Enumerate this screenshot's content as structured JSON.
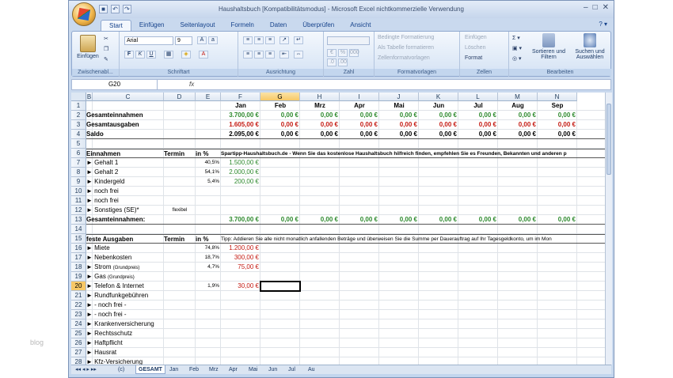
{
  "watermark": "blog",
  "window": {
    "title": "Haushaltsbuch  [Kompatibilitätsmodus]  -  Microsoft Excel nichtkommerzielle Verwendung"
  },
  "ribbon_tabs": [
    "Start",
    "Einfügen",
    "Seitenlayout",
    "Formeln",
    "Daten",
    "Überprüfen",
    "Ansicht"
  ],
  "ribbon": {
    "paste_label": "Einfügen",
    "clipboard_label": "Zwischenabl...",
    "font_name": "Arial",
    "font_size": "9",
    "font_label": "Schriftart",
    "align_label": "Ausrichtung",
    "number_label": "Zahl",
    "cond_format": "Bedingte Formatierung",
    "as_table": "Als Tabelle formatieren",
    "cell_styles": "Zellenformatvorlagen",
    "styles_label": "Formatvorlagen",
    "insert": "Einfügen",
    "delete": "Löschen",
    "format": "Format",
    "cells_label": "Zellen",
    "sort_filter": "Sortieren und Filtern",
    "find_select": "Suchen und Auswählen",
    "edit_label": "Bearbeiten"
  },
  "formula_bar": {
    "name_box": "G20",
    "fx": "fx",
    "value": ""
  },
  "columns": [
    "B",
    "C",
    "D",
    "E",
    "F",
    "G",
    "H",
    "I",
    "J",
    "K",
    "L",
    "M",
    "N"
  ],
  "selected_col": "G",
  "selected_row": "20",
  "months": [
    "Jan",
    "Feb",
    "Mrz",
    "Apr",
    "Mai",
    "Jun",
    "Jul",
    "Aug",
    "Sep"
  ],
  "summary": [
    {
      "label": "Gesamteinnahmen",
      "values": [
        "3.700,00 €",
        "0,00 €",
        "0,00 €",
        "0,00 €",
        "0,00 €",
        "0,00 €",
        "0,00 €",
        "0,00 €",
        "0,00 €"
      ],
      "color": "#2e8a2e"
    },
    {
      "label": "Gesamtausgaben",
      "values": [
        "1.605,00 €",
        "0,00 €",
        "0,00 €",
        "0,00 €",
        "0,00 €",
        "0,00 €",
        "0,00 €",
        "0,00 €",
        "0,00 €"
      ],
      "color": "#c41a12"
    },
    {
      "label": "Saldo",
      "values": [
        "2.095,00 €",
        "0,00 €",
        "0,00 €",
        "0,00 €",
        "0,00 €",
        "0,00 €",
        "0,00 €",
        "0,00 €",
        "0,00 €"
      ],
      "color": "#000000"
    }
  ],
  "income": {
    "header": "Einnahmen",
    "termin": "Termin",
    "pct": "in %",
    "tip": "Spartipp-Haushaltsbuch.de - Wenn Sie das kostenlose Haushaltsbuch hilfreich finden, empfehlen Sie es Freunden, Bekannten und anderen p",
    "rows": [
      {
        "n": "7",
        "label": "► Gehalt 1",
        "termin": "",
        "pct": "40,5%",
        "jan": "1.500,00 €"
      },
      {
        "n": "8",
        "label": "► Gehalt 2",
        "termin": "",
        "pct": "54,1%",
        "jan": "2.000,00 €"
      },
      {
        "n": "9",
        "label": "► Kindergeld",
        "termin": "",
        "pct": "5,4%",
        "jan": "200,00 €"
      },
      {
        "n": "10",
        "label": "► noch frei",
        "termin": "",
        "pct": "",
        "jan": ""
      },
      {
        "n": "11",
        "label": "► noch frei",
        "termin": "",
        "pct": "",
        "jan": ""
      },
      {
        "n": "12",
        "label": "► Sonstiges (SE)*",
        "termin": "flexibel",
        "pct": "",
        "jan": ""
      }
    ],
    "total_label": "Gesamteinnahmen:",
    "total_values": [
      "3.700,00 €",
      "0,00 €",
      "0,00 €",
      "0,00 €",
      "0,00 €",
      "0,00 €",
      "0,00 €",
      "0,00 €",
      "0,00 €"
    ]
  },
  "expenses": {
    "header": "feste Ausgaben",
    "termin": "Termin",
    "pct": "in %",
    "tip": "Tipp: Addieren Sie alle nicht monatlich anfallenden Beträge und überweisen Sie die Summe per Dauerauftrag auf Ihr Tagesgeldkonto, um im Mon",
    "rows": [
      {
        "n": "16",
        "label": "► Miete",
        "pct": "74,8%",
        "jan": "1.200,00 €"
      },
      {
        "n": "17",
        "label": "► Nebenkosten",
        "pct": "18,7%",
        "jan": "300,00 €"
      },
      {
        "n": "18",
        "label": "► Strom",
        "sub": "(Grundpreis)",
        "pct": "4,7%",
        "jan": "75,00 €"
      },
      {
        "n": "19",
        "label": "► Gas",
        "sub": "(Grundpreis)",
        "pct": "",
        "jan": ""
      },
      {
        "n": "20",
        "label": "► Telefon & Internet",
        "pct": "1,9%",
        "jan": "30,00 €"
      },
      {
        "n": "21",
        "label": "► Rundfunkgebühren",
        "pct": "",
        "jan": ""
      },
      {
        "n": "22",
        "label": "►  - noch frei -",
        "pct": "",
        "jan": ""
      },
      {
        "n": "23",
        "label": "►  - noch frei -",
        "pct": "",
        "jan": ""
      },
      {
        "n": "24",
        "label": "► Krankenversicherung",
        "pct": "",
        "jan": ""
      },
      {
        "n": "25",
        "label": "► Rechtsschutz",
        "pct": "",
        "jan": ""
      },
      {
        "n": "26",
        "label": "► Haftpflicht",
        "pct": "",
        "jan": ""
      },
      {
        "n": "27",
        "label": "► Hausrat",
        "pct": "",
        "jan": ""
      },
      {
        "n": "28",
        "label": "► Kfz-Versicherung",
        "pct": "",
        "jan": ""
      }
    ]
  },
  "sheet_tabs": [
    "(c)",
    "GESAMT",
    "Jan",
    "Feb",
    "Mrz",
    "Apr",
    "Mai",
    "Jun",
    "Jul",
    "Au"
  ],
  "active_sheet": "GESAMT"
}
